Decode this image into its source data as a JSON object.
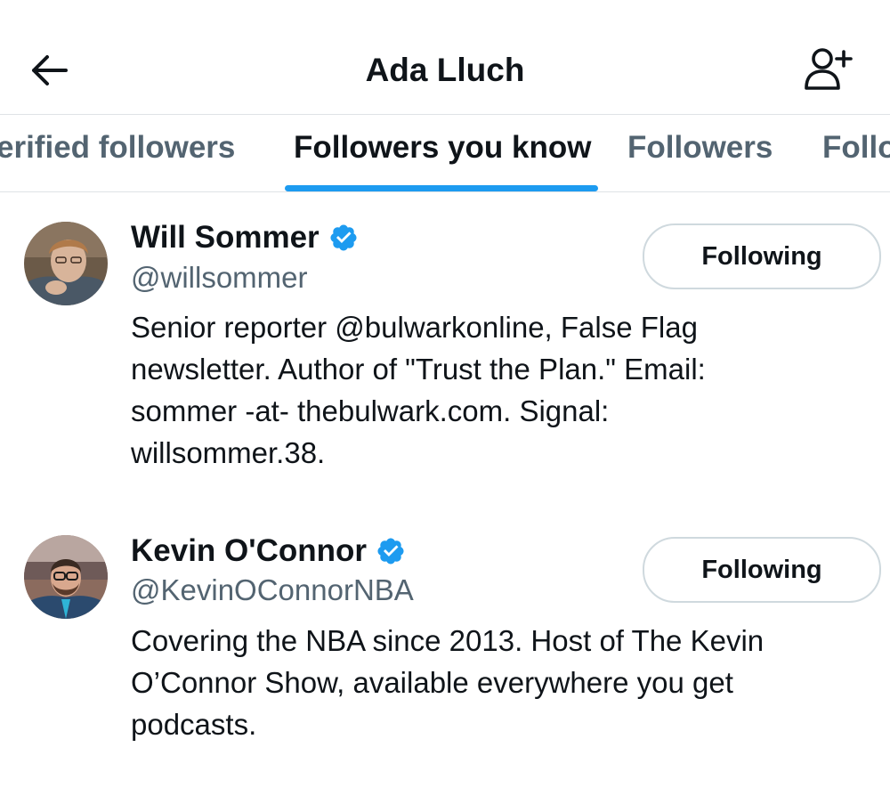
{
  "header": {
    "title": "Ada Lluch",
    "back_icon": "arrow-left-icon",
    "add_user_icon": "person-add-icon"
  },
  "tabs": [
    {
      "label": "Verified followers",
      "visible_text": "erified followers",
      "active": false
    },
    {
      "label": "Followers you know",
      "visible_text": "Followers you know",
      "active": true
    },
    {
      "label": "Followers",
      "visible_text": "Followers",
      "active": false
    },
    {
      "label": "Following",
      "visible_text": "Follo",
      "active": false
    }
  ],
  "accent_color": "#1d9bf0",
  "users": [
    {
      "name": "Will Sommer",
      "verified": true,
      "handle": "@willsommer",
      "bio": "Senior reporter @bulwarkonline, False Flag\nnewsletter. Author of \"Trust the Plan.\" Email:\nsommer -at- thebulwark.com. Signal:\nwillsommer.38.",
      "follow_label": "Following"
    },
    {
      "name": "Kevin O'Connor",
      "verified": true,
      "handle": "@KevinOConnorNBA",
      "bio": "Covering the NBA since 2013. Host of The Kevin\nO’Connor Show, available everywhere you get\npodcasts.",
      "follow_label": "Following"
    }
  ]
}
